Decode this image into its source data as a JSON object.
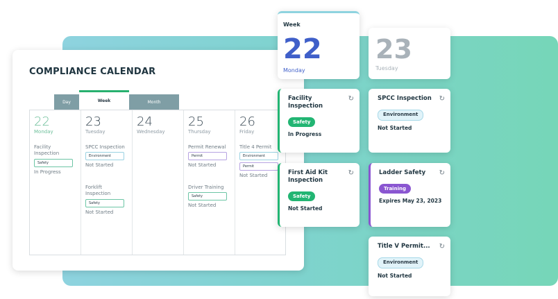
{
  "calendar": {
    "title": "COMPLIANCE CALENDAR",
    "tabs": {
      "day": "Day",
      "week": "Week",
      "month": "Month"
    },
    "days": [
      {
        "num": "22",
        "name": "Monday",
        "events": [
          {
            "title": "Facility Inspection",
            "tag": "Safety",
            "status": "In Progress"
          }
        ]
      },
      {
        "num": "23",
        "name": "Tuesday",
        "events": [
          {
            "title": "SPCC Inspection",
            "tag": "Environment",
            "status": "Not Started"
          },
          {
            "title": "Forklift Inspection",
            "tag": "Safety",
            "status": "Not Started"
          }
        ]
      },
      {
        "num": "24",
        "name": "Wednesday",
        "events": []
      },
      {
        "num": "25",
        "name": "Thursday",
        "events": [
          {
            "title": "Permit Renewal",
            "tag": "Permit",
            "status": "Not Started"
          },
          {
            "title": "Driver Training",
            "tag": "Safety",
            "status": "Not Started"
          }
        ]
      },
      {
        "num": "26",
        "name": "Friday",
        "events": [
          {
            "title": "Title 4 Permit",
            "tag": "Environment",
            "tag2": "Permit",
            "status": "Not Started"
          }
        ]
      }
    ]
  },
  "mobile": {
    "week_label": "Week",
    "today": {
      "num": "22",
      "name": "Monday"
    },
    "next": {
      "num": "23",
      "name": "Tuesday"
    },
    "cards": [
      {
        "title": "Facility Inspection",
        "tag": "Safety",
        "status": "In Progress"
      },
      {
        "title": "SPCC Inspection",
        "tag": "Environment",
        "status": "Not Started"
      },
      {
        "title": "First Aid Kit Inspection",
        "tag": "Safety",
        "status": "Not Started"
      },
      {
        "title": "Ladder Safety",
        "tag": "Training",
        "status": "Expires May 23, 2023"
      },
      {
        "title": "Title V Permit...",
        "tag": "Environment",
        "status": "Not Started"
      }
    ]
  },
  "icons": {
    "sync": "sync-icon"
  },
  "colors": {
    "safety": "#22b573",
    "training": "#8a56d1",
    "accent_blue": "#3f5fc9",
    "environment": "#e1f3f9"
  }
}
